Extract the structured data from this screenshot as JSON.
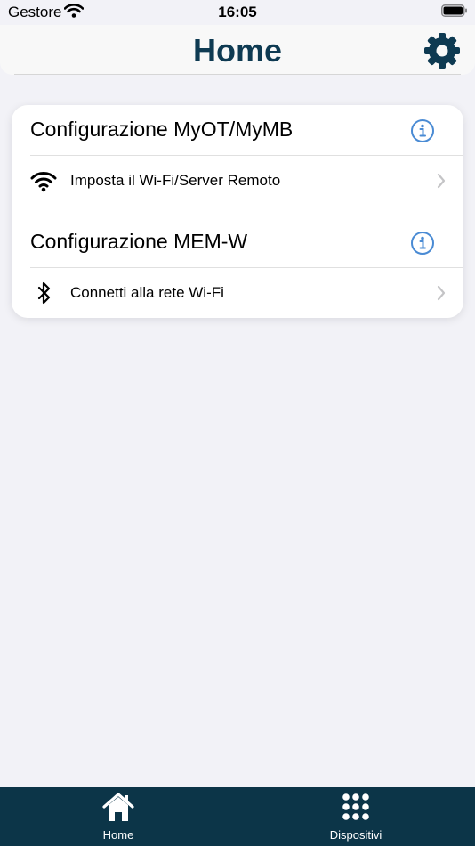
{
  "status_bar": {
    "carrier": "Gestore",
    "time": "16:05",
    "wifi_icon": "wifi-signal-icon",
    "battery_icon": "battery-icon"
  },
  "header": {
    "title": "Home",
    "settings_icon": "gear-icon",
    "title_color": "#0e3a52"
  },
  "sections": [
    {
      "title": "Configurazione MyOT/MyMB",
      "info_icon": "info-icon",
      "row": {
        "icon": "wifi-icon",
        "label": "Imposta il Wi-Fi/Server Remoto"
      }
    },
    {
      "title": "Configurazione MEM-W",
      "info_icon": "info-icon",
      "row": {
        "icon": "bluetooth-icon",
        "label": "Connetti alla rete Wi-Fi"
      }
    }
  ],
  "tab_bar": {
    "background": "#0c3548",
    "tabs": [
      {
        "label": "Home",
        "icon": "house-icon"
      },
      {
        "label": "Dispositivi",
        "icon": "grid-dots-icon"
      }
    ]
  },
  "colors": {
    "accent": "#4a8bd4",
    "background": "#f2f2f7",
    "card": "#ffffff"
  }
}
